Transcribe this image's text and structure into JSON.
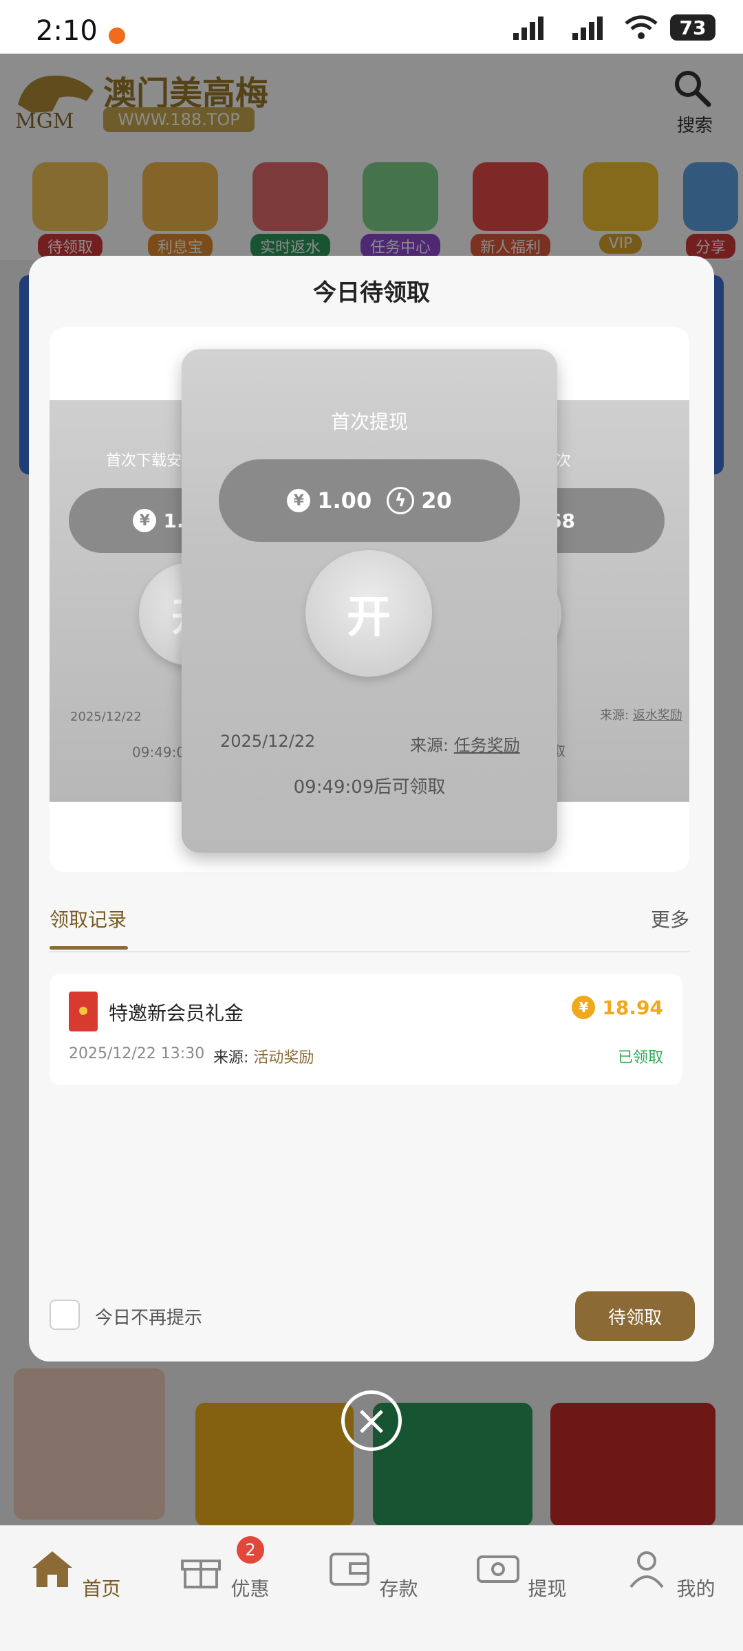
{
  "status_bar": {
    "time": "2:10",
    "battery": "73"
  },
  "header": {
    "brand_name": "澳门美高梅",
    "brand_url": "WWW.188.TOP",
    "search_label": "搜索",
    "logo_text": "MGM"
  },
  "categories": [
    {
      "label": "待领取",
      "color": "#d13a3a"
    },
    {
      "label": "利息宝",
      "color": "#e08a2b"
    },
    {
      "label": "实时返水",
      "color": "#2f9a5b"
    },
    {
      "label": "任务中心",
      "color": "#8f4ad1"
    },
    {
      "label": "新人福利",
      "color": "#e05a3a"
    },
    {
      "label": "VIP",
      "color": "#d9a52a"
    },
    {
      "label": "分享",
      "color": "#d13a3a"
    }
  ],
  "modal": {
    "title": "今日待领取",
    "center_card": {
      "title": "首次提现",
      "amount": "1.00",
      "bolt_value": "20",
      "open_label": "开",
      "date": "2025/12/22",
      "source_prefix": "来源:",
      "source": "任务奖励",
      "countdown": "09:49:09后可领取"
    },
    "left_card": {
      "title": "首次下载安",
      "amount": "1.00",
      "open_label": "开",
      "date": "2025/12/22",
      "countdown": "09:49:0"
    },
    "right_card": {
      "title": "次",
      "amount": "68",
      "open_label": "开",
      "source_prefix": "来源:",
      "source": "返水奖励",
      "countdown": "后可领取"
    },
    "records": {
      "tab": "领取记录",
      "more": "更多",
      "items": [
        {
          "title": "特邀新会员礼金",
          "amount": "18.94",
          "datetime": "2025/12/22 13:30",
          "source_prefix": "来源:",
          "source": "活动奖励",
          "status": "已领取"
        }
      ]
    },
    "no_remind": "今日不再提示",
    "claim_button": "待领取"
  },
  "bottom_nav": {
    "items": [
      {
        "label": "首页",
        "active": true
      },
      {
        "label": "优惠",
        "badge": "2"
      },
      {
        "label": "存款"
      },
      {
        "label": "提现"
      },
      {
        "label": "我的"
      }
    ]
  },
  "colors": {
    "brand": "#8b6a35",
    "gold": "#f0a81c",
    "claimed": "#2fa84f"
  }
}
